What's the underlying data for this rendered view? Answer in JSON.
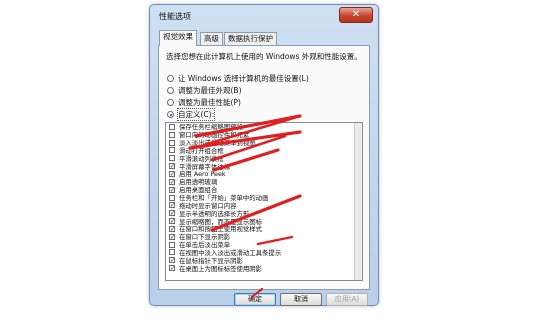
{
  "window": {
    "title": "性能选项",
    "close_glyph": "✕"
  },
  "tabs": [
    {
      "label": "视觉效果"
    },
    {
      "label": "高级"
    },
    {
      "label": "数据执行保护"
    }
  ],
  "description": "选择您想在此计算机上使用的 Windows 外观和性能设置。",
  "radios": [
    {
      "label": "让 Windows 选择计算机的最佳设置(L)",
      "checked": false
    },
    {
      "label": "调整为最佳外观(B)",
      "checked": false
    },
    {
      "label": "调整为最佳性能(P)",
      "checked": false
    },
    {
      "label": "自定义(C):",
      "checked": true
    }
  ],
  "options": [
    {
      "label": "保存任务栏缩略图预览",
      "checked": false
    },
    {
      "label": "窗口内的动画控件和元素",
      "checked": false
    },
    {
      "label": "淡入淡出或滑动菜单到视图",
      "checked": false
    },
    {
      "label": "滑动打开组合框",
      "checked": false
    },
    {
      "label": "平滑滚动列表框",
      "checked": false
    },
    {
      "label": "平滑屏幕字体边缘",
      "checked": true
    },
    {
      "label": "启用 Aero Peek",
      "checked": true
    },
    {
      "label": "启用透明玻璃",
      "checked": true
    },
    {
      "label": "启用桌面组合",
      "checked": true
    },
    {
      "label": "任务栏和「开始」菜单中的动画",
      "checked": false
    },
    {
      "label": "拖动时显示窗口内容",
      "checked": true
    },
    {
      "label": "显示半透明的选择长方形",
      "checked": true
    },
    {
      "label": "显示缩略图，而不是显示图标",
      "checked": true
    },
    {
      "label": "在窗口和按钮上使用视觉样式",
      "checked": true
    },
    {
      "label": "在窗口下显示阴影",
      "checked": true
    },
    {
      "label": "在单击后淡出菜单",
      "checked": false
    },
    {
      "label": "在视图中淡入淡出或滑动工具条提示",
      "checked": false
    },
    {
      "label": "在鼠标指针下显示阴影",
      "checked": true
    },
    {
      "label": "在桌面上为图标标签使用阴影",
      "checked": true
    }
  ],
  "buttons": {
    "ok": "确定",
    "cancel": "取消",
    "apply": "应用(A)"
  },
  "annotation_color": "#e02020"
}
